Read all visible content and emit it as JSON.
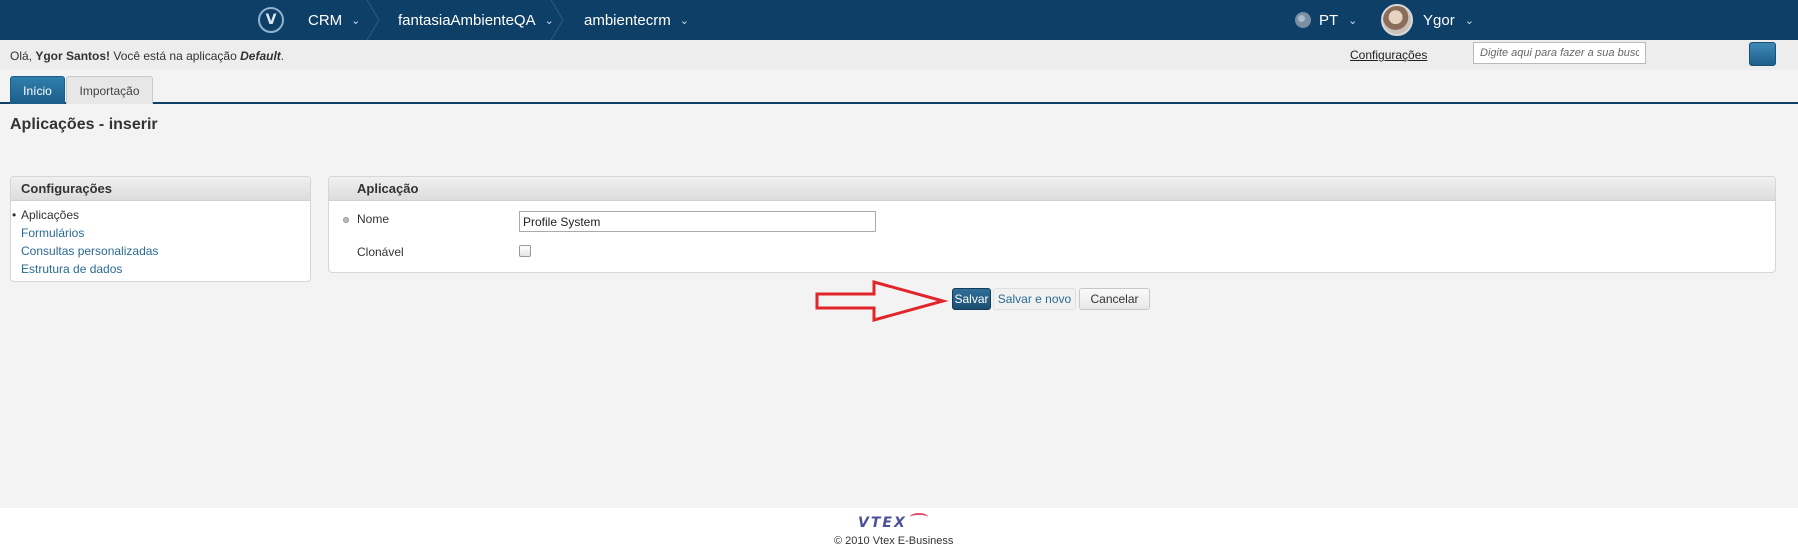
{
  "topbar": {
    "logo_letter": "V",
    "breadcrumbs": [
      {
        "label": "CRM"
      },
      {
        "label": "fantasiaAmbienteQA"
      },
      {
        "label": "ambientecrm"
      }
    ],
    "language": "PT",
    "user_name": "Ygor",
    "chevron": "⌄"
  },
  "subbar": {
    "greeting_prefix": "Olá, ",
    "greeting_name": "Ygor Santos!",
    "greeting_middle": " Você está na aplicação ",
    "greeting_app": "Default",
    "greeting_suffix": ".",
    "settings_link": "Configurações",
    "search_placeholder": "Digite aqui para fazer a sua busca..."
  },
  "tabs": [
    {
      "label": "Início",
      "active": true
    },
    {
      "label": "Importação",
      "active": false
    }
  ],
  "page_title": "Aplicações - inserir",
  "left_panel": {
    "title": "Configurações",
    "items": [
      {
        "label": "Aplicações",
        "current": true
      },
      {
        "label": "Formulários"
      },
      {
        "label": "Consultas personalizadas"
      },
      {
        "label": "Estrutura de dados"
      }
    ]
  },
  "form": {
    "title": "Aplicação",
    "name_label": "Nome",
    "name_value": "Profile System",
    "clonable_label": "Clonável",
    "clonable_checked": false
  },
  "buttons": {
    "save": "Salvar",
    "save_new": "Salvar e novo",
    "cancel": "Cancelar"
  },
  "footer": {
    "logo_text": "VTEX",
    "copyright": "© 2010 Vtex E-Business"
  },
  "colors": {
    "topbar": "#0e3f66",
    "accent": "#1b5d88",
    "arrow": "#e0252b"
  }
}
